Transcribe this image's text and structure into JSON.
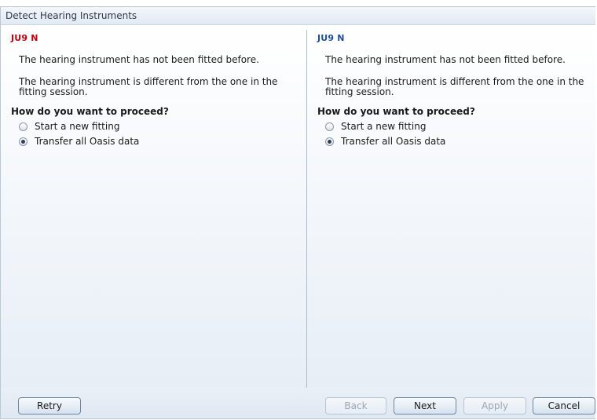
{
  "window": {
    "title": "Detect Hearing Instruments"
  },
  "panels": {
    "left": {
      "device": "JU9 N",
      "message1": "The hearing instrument has not been fitted before.",
      "message2": "The hearing instrument is different from the one in the fitting session.",
      "question": "How do you want to proceed?",
      "options": [
        {
          "label": "Start a new fitting",
          "selected": false
        },
        {
          "label": "Transfer all Oasis data",
          "selected": true
        }
      ]
    },
    "right": {
      "device": "JU9 N",
      "message1": "The hearing instrument has not been fitted before.",
      "message2": "The hearing instrument is different from the one in the fitting session.",
      "question": "How do you want to proceed?",
      "options": [
        {
          "label": "Start a new fitting",
          "selected": false
        },
        {
          "label": "Transfer all Oasis data",
          "selected": true
        }
      ]
    }
  },
  "buttons": {
    "retry": "Retry",
    "back": "Back",
    "next": "Next",
    "apply": "Apply",
    "cancel": "Cancel"
  },
  "colors": {
    "left_device": "#c0000f",
    "right_device": "#1f4f96"
  }
}
